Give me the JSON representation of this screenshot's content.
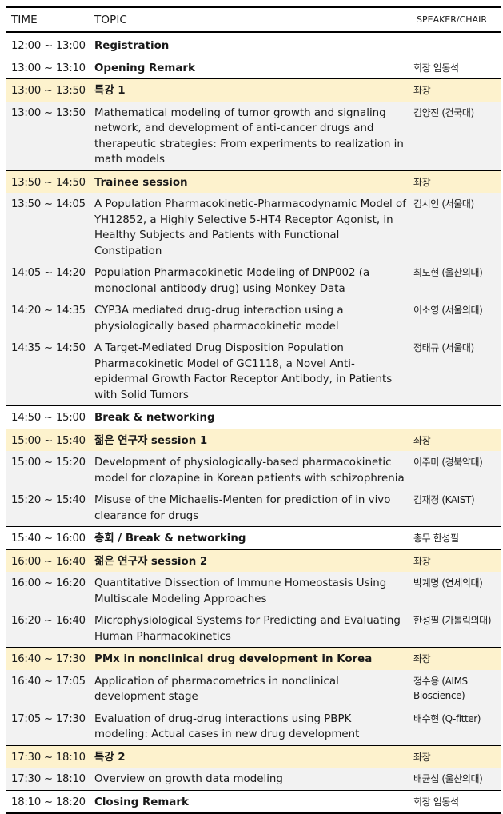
{
  "header": {
    "time": "TIME",
    "topic": "TOPIC",
    "speaker": "SPEAKER/CHAIR"
  },
  "rows": [
    {
      "time": "12:00 ~ 13:00",
      "topic": "Registration",
      "speaker": "",
      "kind": "plain",
      "bold": true,
      "sep": false
    },
    {
      "time": "13:00 ~ 13:10",
      "topic": "Opening Remark",
      "speaker": "회장 임동석",
      "kind": "plain",
      "bold": true,
      "sep": false
    },
    {
      "time": "13:00 ~ 13:50",
      "topic": "특강 1",
      "speaker": "좌장",
      "kind": "hl",
      "bold": true,
      "sep": true
    },
    {
      "time": "13:00 ~ 13:50",
      "topic": "Mathematical modeling of tumor growth and signaling network, and development of anti-cancer drugs and therapeutic strategies: From experiments to realization in math models",
      "speaker": "김양진 (건국대)",
      "kind": "sub",
      "bold": false,
      "sep": false
    },
    {
      "time": "13:50 ~ 14:50",
      "topic": "Trainee session",
      "speaker": "좌장",
      "kind": "hl",
      "bold": true,
      "sep": true
    },
    {
      "time": "13:50 ~ 14:05",
      "topic": "A Population Pharmacokinetic-Pharmacodynamic Model of YH12852, a Highly Selective 5-HT4 Receptor Agonist, in Healthy Subjects and Patients with Functional Constipation",
      "speaker": "김시언 (서울대)",
      "kind": "sub",
      "bold": false,
      "sep": false
    },
    {
      "time": "14:05 ~ 14:20",
      "topic": "Population Pharmacokinetic Modeling of DNP002 (a monoclonal antibody drug) using Monkey Data",
      "speaker": "최도현 (울산의대)",
      "kind": "sub",
      "bold": false,
      "sep": false
    },
    {
      "time": "14:20 ~ 14:35",
      "topic": "CYP3A mediated drug-drug interaction using a physiologically based pharmacokinetic model",
      "speaker": "이소영 (서울의대)",
      "kind": "sub",
      "bold": false,
      "sep": false
    },
    {
      "time": "14:35 ~ 14:50",
      "topic": "A Target-Mediated Drug Disposition Population Pharmacokinetic Model of GC1118, a Novel Anti-epidermal Growth Factor Receptor Antibody, in Patients with Solid Tumors",
      "speaker": "정태규 (서울대)",
      "kind": "sub",
      "bold": false,
      "sep": false
    },
    {
      "time": "14:50 ~ 15:00",
      "topic": "Break & networking",
      "speaker": "",
      "kind": "plain",
      "bold": true,
      "sep": true
    },
    {
      "time": "15:00 ~ 15:40",
      "topic": "젊은 연구자 session 1",
      "speaker": "좌장",
      "kind": "hl",
      "bold": true,
      "sep": true
    },
    {
      "time": "15:00 ~ 15:20",
      "topic": "Development of physiologically-based pharmacokinetic model for clozapine in Korean patients with schizophrenia",
      "speaker": "이주미 (경북약대)",
      "kind": "sub",
      "bold": false,
      "sep": false
    },
    {
      "time": "15:20 ~ 15:40",
      "topic": "Misuse of the Michaelis-Menten for prediction of in vivo clearance for drugs",
      "speaker": "김재경 (KAIST)",
      "kind": "sub",
      "bold": false,
      "sep": false
    },
    {
      "time": "15:40 ~ 16:00",
      "topic": "총회 / Break & networking",
      "speaker": "총무 한성필",
      "kind": "plain",
      "bold": true,
      "sep": true
    },
    {
      "time": "16:00 ~ 16:40",
      "topic": "젊은 연구자 session 2",
      "speaker": "좌장",
      "kind": "hl",
      "bold": true,
      "sep": true
    },
    {
      "time": "16:00 ~ 16:20",
      "topic": "Quantitative Dissection of Immune Homeostasis Using Multiscale Modeling Approaches",
      "speaker": "박계명 (연세의대)",
      "kind": "sub",
      "bold": false,
      "sep": false
    },
    {
      "time": "16:20 ~ 16:40",
      "topic": "Microphysiological Systems for Predicting and Evaluating Human Pharmacokinetics",
      "speaker": "한성필 (가톨릭의대)",
      "kind": "sub",
      "bold": false,
      "sep": false
    },
    {
      "time": "16:40 ~ 17:30",
      "topic": "PMx in nonclinical drug development in Korea",
      "speaker": "좌장",
      "kind": "hl",
      "bold": true,
      "sep": true
    },
    {
      "time": "16:40 ~ 17:05",
      "topic": "Application of pharmacometrics in nonclinical development stage",
      "speaker": "정수용 (AIMS Bioscience)",
      "kind": "sub",
      "bold": false,
      "sep": false
    },
    {
      "time": "17:05 ~ 17:30",
      "topic": "Evaluation of drug-drug interactions using PBPK modeling: Actual cases in new drug development",
      "speaker": "배수현 (Q-fitter)",
      "kind": "sub",
      "bold": false,
      "sep": false
    },
    {
      "time": "17:30 ~ 18:10",
      "topic": "특강 2",
      "speaker": "좌장",
      "kind": "hl",
      "bold": true,
      "sep": true
    },
    {
      "time": "17:30 ~ 18:10",
      "topic": "Overview on growth data modeling",
      "speaker": "배균섭 (울산의대)",
      "kind": "sub",
      "bold": false,
      "sep": false
    },
    {
      "time": "18:10 ~ 18:20",
      "topic": "Closing Remark",
      "speaker": "회장 임동석",
      "kind": "plain",
      "bold": true,
      "sep": true
    }
  ],
  "colors": {
    "highlight": "#fdf2cd",
    "sub": "#f2f2f2",
    "rule": "#000000"
  }
}
